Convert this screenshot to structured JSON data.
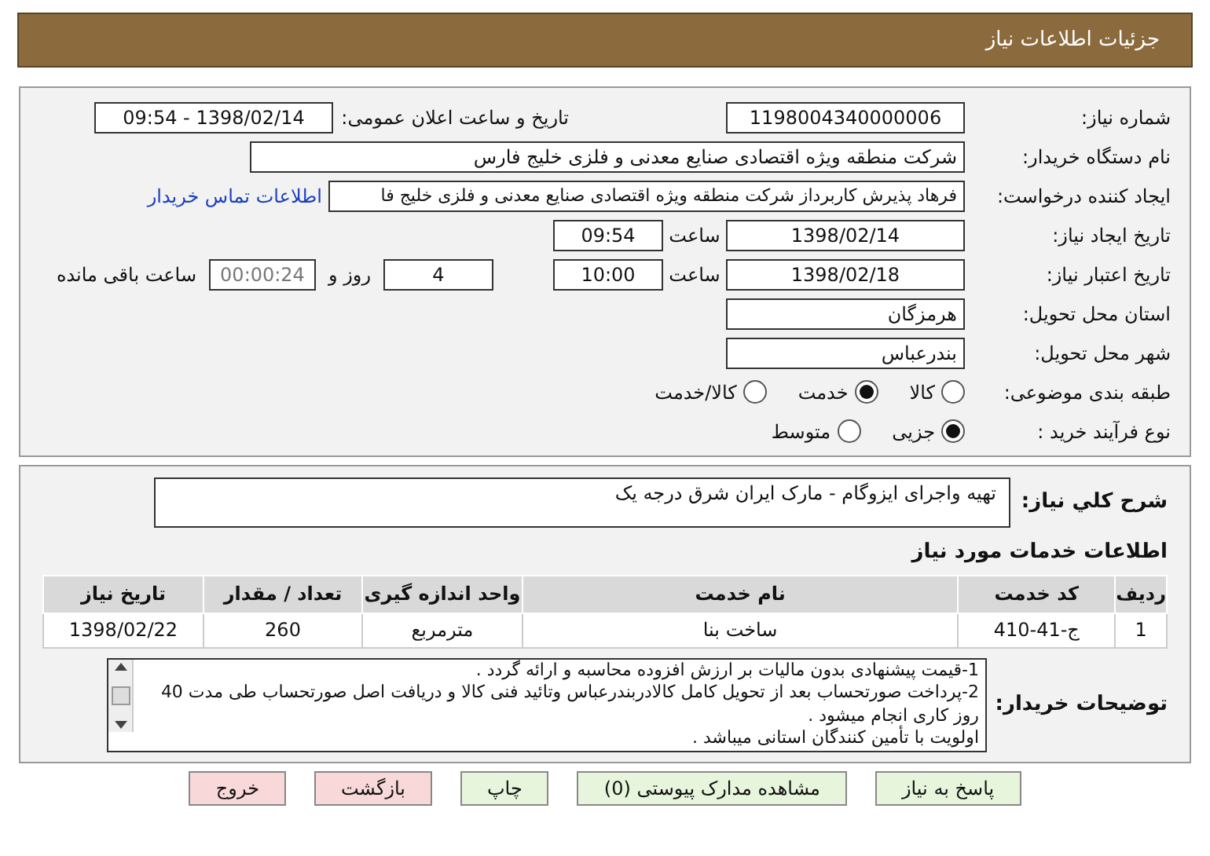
{
  "header": {
    "title": "جزئیات اطلاعات نیاز"
  },
  "need_number": {
    "label": "شماره نیاز:",
    "value": "1198004340000006"
  },
  "announce": {
    "label": "تاریخ و ساعت اعلان عمومی:",
    "value": "1398/02/14 - 09:54"
  },
  "buyer_org": {
    "label": "نام دستگاه خریدار:",
    "value": "شرکت منطقه ویژه اقتصادی صنایع معدنی و فلزی خلیج فارس"
  },
  "requester": {
    "label": "ایجاد کننده درخواست:",
    "value": "فرهاد پذیرش  کاربرداز شرکت منطقه ویژه اقتصادی صنایع معدنی و فلزی خلیج فا",
    "link": "اطلاعات تماس خریدار"
  },
  "created": {
    "label": "تاریخ ایجاد نیاز:",
    "date": "1398/02/14",
    "time_label": "ساعت",
    "time": "09:54"
  },
  "validity": {
    "label": "تاریخ اعتبار نیاز:",
    "date": "1398/02/18",
    "time_label": "ساعت",
    "time": "10:00",
    "days": "4",
    "days_label": "روز و",
    "remaining": "00:00:24",
    "remaining_label": "ساعت باقی مانده"
  },
  "province": {
    "label": "استان محل تحویل:",
    "value": "هرمزگان"
  },
  "city": {
    "label": "شهر محل تحویل:",
    "value": "بندرعباس"
  },
  "category": {
    "label": "طبقه بندی موضوعی:",
    "options": [
      {
        "label": "کالا",
        "selected": false
      },
      {
        "label": "خدمت",
        "selected": true
      },
      {
        "label": "کالا/خدمت",
        "selected": false
      }
    ]
  },
  "purchase_type": {
    "label": "نوع فرآیند خرید :",
    "options": [
      {
        "label": "جزیی",
        "selected": true
      },
      {
        "label": "متوسط",
        "selected": false
      }
    ]
  },
  "description": {
    "label": "شرح کلي نیاز:",
    "value": "تهیه واجرای ایزوگام - مارک ایران شرق درجه یک"
  },
  "services": {
    "title": "اطلاعات خدمات مورد نیاز",
    "columns": [
      "ردیف",
      "کد خدمت",
      "نام خدمت",
      "واحد اندازه گیری",
      "تعداد / مقدار",
      "تاریخ نیاز"
    ],
    "rows": [
      [
        "1",
        "ج-41-410",
        "ساخت بنا",
        "مترمربع",
        "260",
        "1398/02/22"
      ]
    ]
  },
  "buyer_notes": {
    "label": "توضیحات خریدار:",
    "lines": [
      "1-قیمت پیشنهادی بدون مالیات بر ارزش افزوده محاسبه و ارائه گردد .",
      "2-پرداخت صورتحساب بعد از تحویل کامل کالادربندرعباس وتائید فنی کالا و دریافت اصل صورتحساب طی مدت 40 روز کاری انجام میشود .",
      "اولویت با تأمین کنندگان استانی میباشد ."
    ]
  },
  "buttons": [
    {
      "label": "پاسخ به نیاز",
      "kind": "primary"
    },
    {
      "label": "مشاهده مدارک پیوستی (0)",
      "kind": "primary"
    },
    {
      "label": "چاپ",
      "kind": "primary"
    },
    {
      "label": "بازگشت",
      "kind": "danger"
    },
    {
      "label": "خروج",
      "kind": "danger"
    }
  ]
}
